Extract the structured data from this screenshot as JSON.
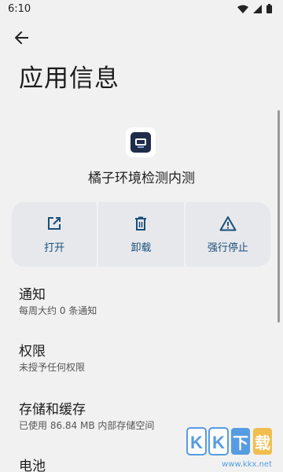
{
  "status_bar": {
    "time": "6:10",
    "icons": [
      "wifi-icon",
      "signal-icon",
      "battery-icon"
    ]
  },
  "header": {
    "back_icon": "arrow-back-icon",
    "title": "应用信息"
  },
  "app": {
    "name": "橘子环境检测内测",
    "icon": "app-icon"
  },
  "actions": [
    {
      "label": "打开",
      "icon": "open-external-icon"
    },
    {
      "label": "卸载",
      "icon": "trash-icon"
    },
    {
      "label": "强行停止",
      "icon": "warning-icon"
    }
  ],
  "settings": [
    {
      "title": "通知",
      "subtitle": "每周大约 0 条通知"
    },
    {
      "title": "权限",
      "subtitle": "未授予任何权限"
    },
    {
      "title": "存储和缓存",
      "subtitle": "已使用 86.84 MB 内部存储空间"
    },
    {
      "title": "电池",
      "subtitle": ""
    }
  ],
  "watermark": {
    "site": "www.kkx.net"
  },
  "colors": {
    "background": "#f1f1f1",
    "action_bg": "#e6e8ec",
    "accent": "#1a4f7a"
  }
}
